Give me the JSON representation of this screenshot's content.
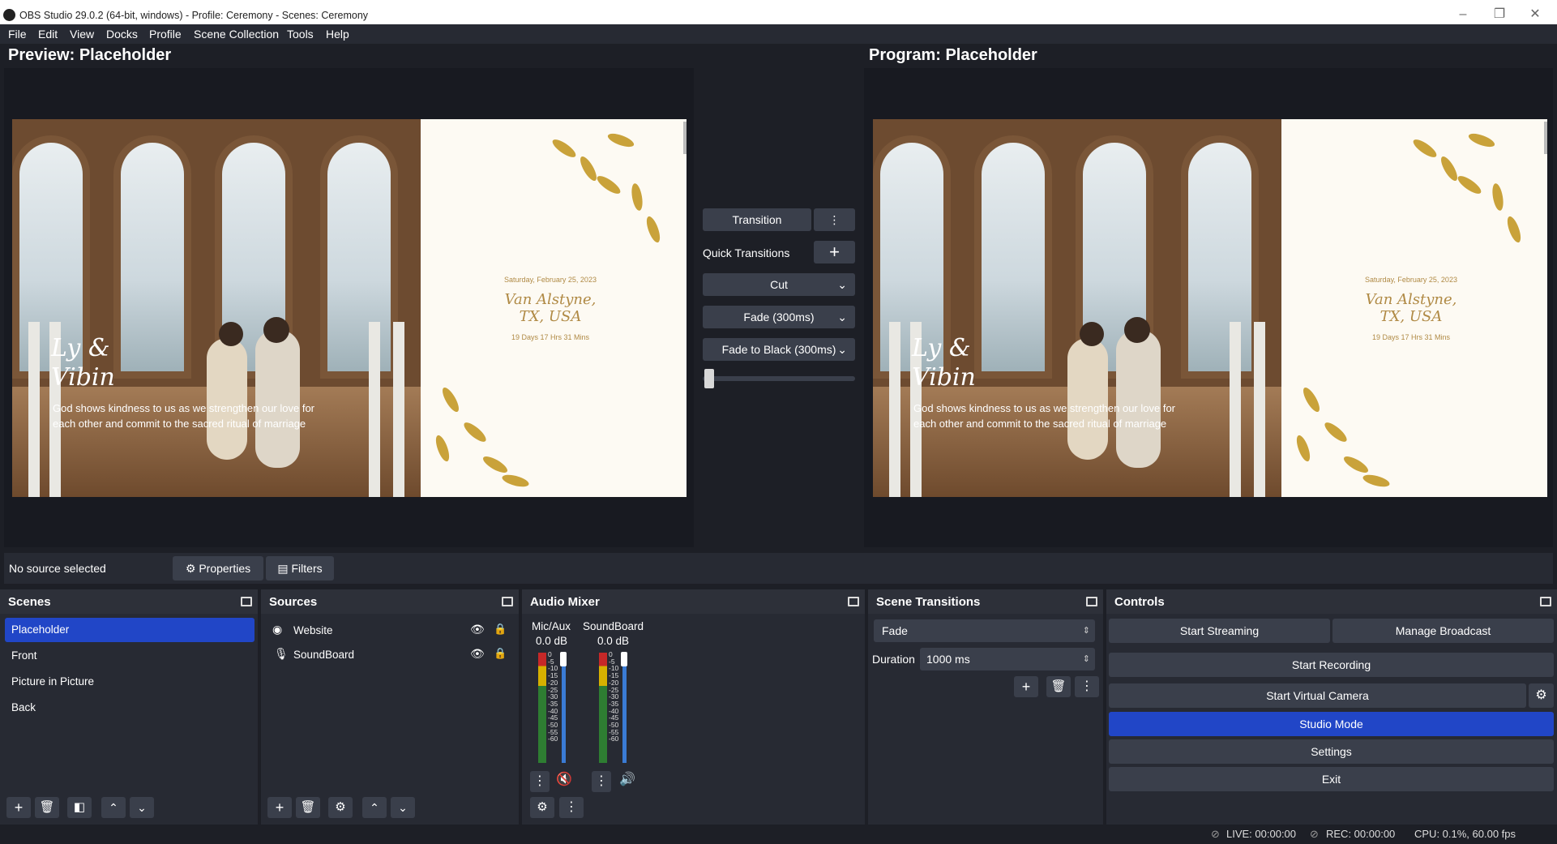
{
  "titlebar": {
    "title": "OBS Studio 29.0.2 (64-bit, windows) - Profile: Ceremony - Scenes: Ceremony"
  },
  "menu": [
    "File",
    "Edit",
    "View",
    "Docks",
    "Profile",
    "Scene Collection",
    "Tools",
    "Help"
  ],
  "preview": {
    "title": "Preview: Placeholder"
  },
  "program": {
    "title": "Program: Placeholder"
  },
  "card": {
    "names": "Ly & Vibin",
    "date": "Saturday, February 25, 2023",
    "location_line1": "Van Alstyne,",
    "location_line2": "TX, USA",
    "countdown": "19 Days  17 Hrs  31 Mins",
    "quote": "God shows kindness to us as we strengthen our love for each other and commit to the sacred ritual of marriage"
  },
  "transition_panel": {
    "transition_label": "Transition",
    "quick_transitions_label": "Quick Transitions",
    "quick": [
      "Cut",
      "Fade (300ms)",
      "Fade to Black (300ms)"
    ],
    "tbar_position": 0
  },
  "source_toolbar": {
    "no_source": "No source selected",
    "properties": "Properties",
    "filters": "Filters"
  },
  "scenes": {
    "title": "Scenes",
    "items": [
      "Placeholder",
      "Front",
      "Picture in Picture",
      "Back"
    ],
    "selected": "Placeholder"
  },
  "sources": {
    "title": "Sources",
    "items": [
      {
        "name": "Website",
        "icon": "globe-icon"
      },
      {
        "name": "SoundBoard",
        "icon": "microphone-icon"
      }
    ]
  },
  "audio_mixer": {
    "title": "Audio Mixer",
    "channels": [
      {
        "name": "Mic/Aux",
        "level": "0.0 dB",
        "muted": true
      },
      {
        "name": "SoundBoard",
        "level": "0.0 dB",
        "muted": false
      }
    ],
    "scale": [
      "0",
      "-5",
      "-10",
      "-15",
      "-20",
      "-25",
      "-30",
      "-35",
      "-40",
      "-45",
      "-50",
      "-55",
      "-60"
    ]
  },
  "scene_transitions": {
    "title": "Scene Transitions",
    "selected": "Fade",
    "duration_label": "Duration",
    "duration_value": "1000 ms"
  },
  "controls": {
    "title": "Controls",
    "start_streaming": "Start Streaming",
    "manage_broadcast": "Manage Broadcast",
    "start_recording": "Start Recording",
    "start_virtual_camera": "Start Virtual Camera",
    "studio_mode": "Studio Mode",
    "settings": "Settings",
    "exit": "Exit"
  },
  "status": {
    "live": "LIVE: 00:00:00",
    "rec": "REC: 00:00:00",
    "cpu": "CPU: 0.1%, 60.00 fps"
  },
  "colors": {
    "accent": "#2146c7",
    "background": "#1d1f26",
    "panel": "#272a33",
    "button": "#3a3f4b"
  }
}
